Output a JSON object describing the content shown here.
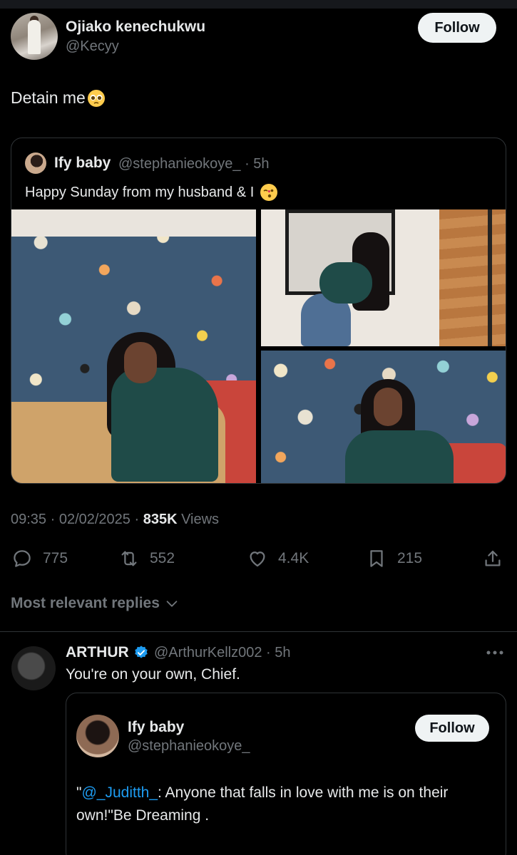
{
  "tweet": {
    "author_name": "Ojiako kenechukwu",
    "author_handle": "@Kecyy",
    "follow_label": "Follow",
    "text": "Detain me",
    "timestamp": "09:35 · 02/02/2025 · ",
    "views_count": "835K",
    "views_label": " Views",
    "actions": {
      "replies": "775",
      "reposts": "552",
      "likes": "4.4K",
      "bookmarks": "215"
    }
  },
  "quoted": {
    "author_name": "Ify baby",
    "meta": "@stephanieokoye_ · 5h",
    "text": "Happy Sunday from my husband & I"
  },
  "sort_label": "Most relevant replies",
  "reply": {
    "author_name": "ARTHUR",
    "meta": "@ArthurKellz002 · 5h",
    "text": "You're on your own, Chief.",
    "card": {
      "name": "Ify baby",
      "handle": "@stephanieokoye_",
      "follow_label": "Follow",
      "quote_open": "\"",
      "mention": "@_Juditth_",
      "quote_body": ": Anyone that falls in love with me is on their own!\"Be Dreaming ."
    }
  },
  "colors": {
    "background": "#000000",
    "accent": "#1d9bf0",
    "secondary_text": "#71767b",
    "border": "#2f3336"
  }
}
